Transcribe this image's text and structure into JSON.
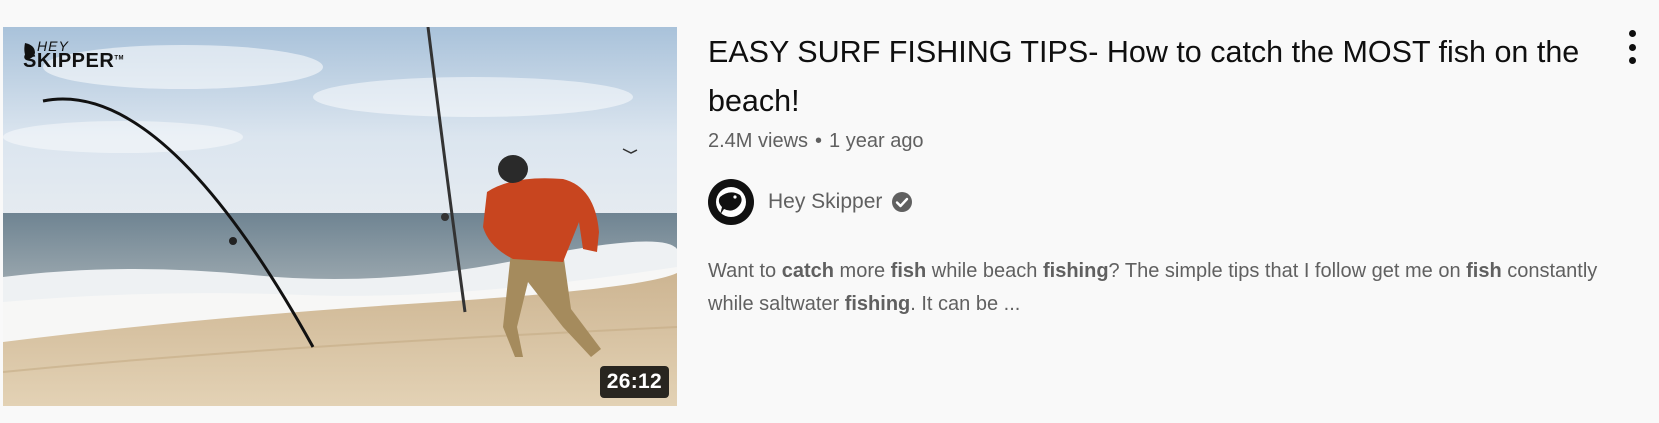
{
  "video": {
    "thumbnail": {
      "logo_top": "HEY",
      "logo_main": "SKIPPER",
      "logo_tm": "TM",
      "duration": "26:12"
    },
    "title": "EASY SURF FISHING TIPS- How to catch the MOST fish on the beach!",
    "views": "2.4M views",
    "separator": "•",
    "published": "1 year ago",
    "channel": {
      "name": "Hey Skipper",
      "verified_icon": "verified-check-icon"
    },
    "description": {
      "p1": "Want to ",
      "b1": "catch",
      "p2": " more ",
      "b2": "fish",
      "p3": " while beach ",
      "b3": "fishing",
      "p4": "? The simple tips that I follow get me on ",
      "b4": "fish",
      "p5": " constantly while saltwater ",
      "b5": "fishing",
      "p6": ". It can be ..."
    },
    "menu_icon": "more-vert-icon"
  }
}
